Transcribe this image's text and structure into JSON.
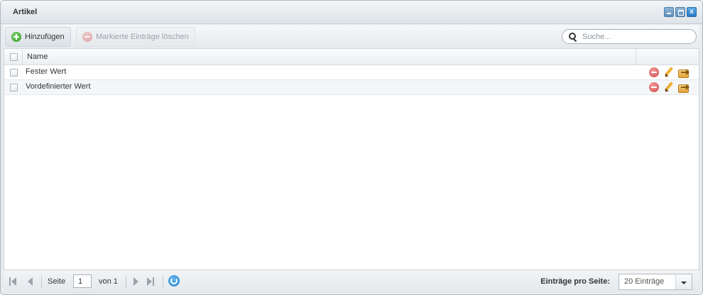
{
  "window": {
    "title": "Artikel"
  },
  "toolbar": {
    "add_label": "Hinzufügen",
    "delete_label": "Markierte Einträge löschen",
    "search_placeholder": "Suche..."
  },
  "grid": {
    "columns": [
      "Name"
    ],
    "rows": [
      {
        "name": "Fester Wert"
      },
      {
        "name": "Vordefinierter Wert"
      }
    ]
  },
  "pager": {
    "page_label": "Seite",
    "page_value": "1",
    "of_label": "von 1",
    "per_page_label": "Einträge pro Seite:",
    "per_page_value": "20 Einträge"
  },
  "icons": {
    "add": "plus-circle-icon",
    "delete": "minus-circle-icon",
    "search": "magnifier-icon",
    "row_delete": "minus-circle-icon",
    "row_edit": "pencil-icon",
    "row_move": "move-icon",
    "refresh": "refresh-icon"
  },
  "colors": {
    "add_green": "#2e9a1f",
    "delete_red": "#d24848",
    "window_button_blue": "#2b7bc4"
  }
}
